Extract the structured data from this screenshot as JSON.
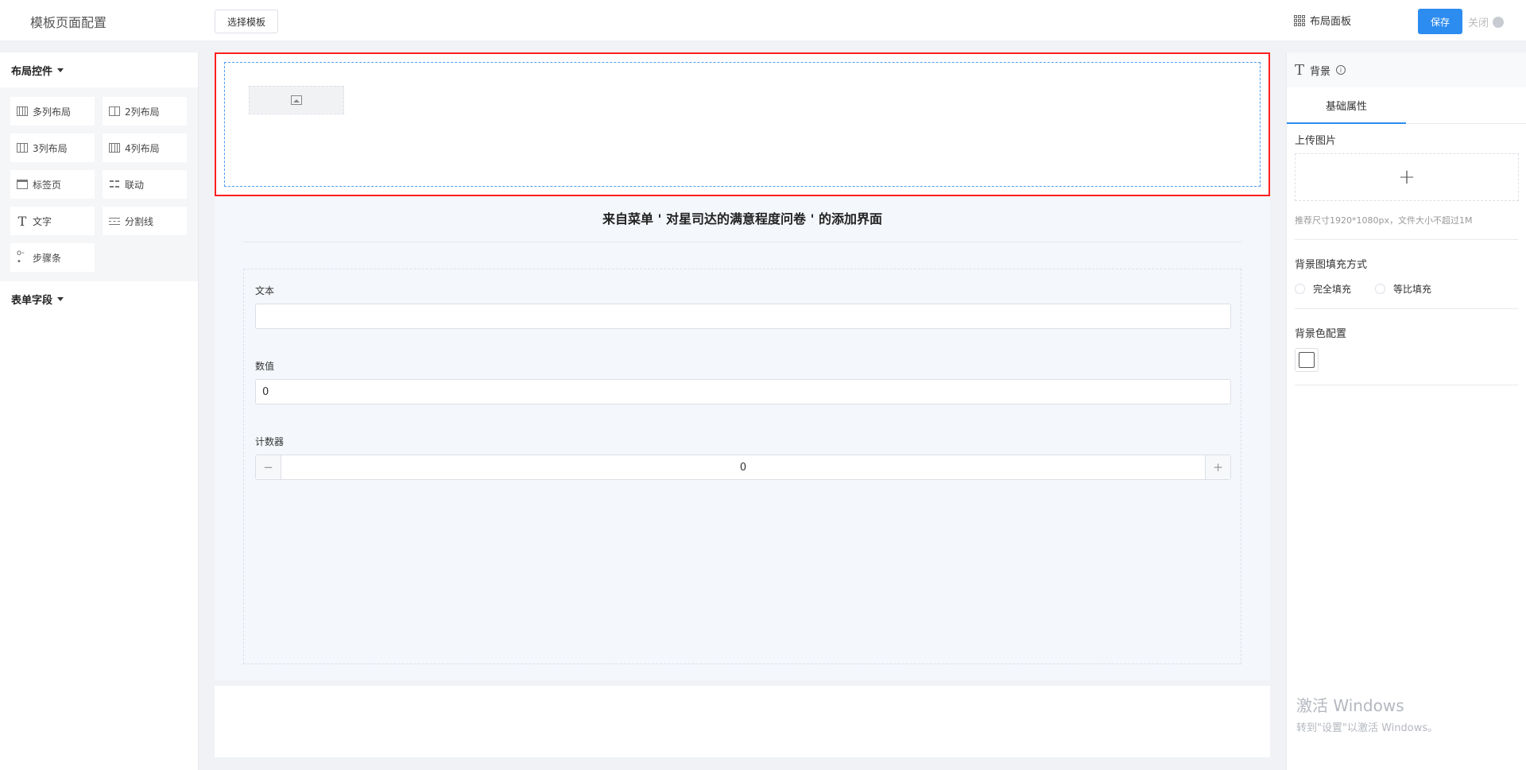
{
  "topbar": {
    "title": "模板页面配置",
    "select_template_label": "选择模板",
    "layout_panel_label": "布局面板",
    "save_label": "保存",
    "close_label": "关闭",
    "save_color": "#2d8cf0"
  },
  "left": {
    "layout_section": "布局控件",
    "controls": [
      {
        "label": "多列布局",
        "icon": "multi-column-icon"
      },
      {
        "label": "2列布局",
        "icon": "two-column-icon"
      },
      {
        "label": "3列布局",
        "icon": "three-column-icon"
      },
      {
        "label": "4列布局",
        "icon": "four-column-icon"
      },
      {
        "label": "标签页",
        "icon": "tabs-icon"
      },
      {
        "label": "联动",
        "icon": "linkage-icon"
      },
      {
        "label": "文字",
        "icon": "text-icon"
      },
      {
        "label": "分割线",
        "icon": "divider-icon"
      },
      {
        "label": "步骤条",
        "icon": "steps-icon"
      }
    ],
    "form_section": "表单字段"
  },
  "canvas": {
    "form_title": "来自菜单 ' 对星司达的满意程度问卷 ' 的添加界面",
    "fields": {
      "text_label": "文本",
      "text_value": "",
      "number_label": "数值",
      "number_value": "0",
      "counter_label": "计数器",
      "counter_value": "0",
      "minus": "−",
      "plus": "+"
    },
    "highlight_color": "#ff1f1f"
  },
  "right": {
    "panel_title": "背景",
    "tab_label": "基础属性",
    "upload_label": "上传图片",
    "upload_plus": "+",
    "upload_hint": "推荐尺寸1920*1080px，文件大小不超过1M",
    "fill_label": "背景图填充方式",
    "fill_options": [
      "完全填充",
      "等比填充"
    ],
    "color_label": "背景色配置"
  },
  "watermark": {
    "line1": "激活 Windows",
    "line2": "转到\"设置\"以激活 Windows。"
  }
}
